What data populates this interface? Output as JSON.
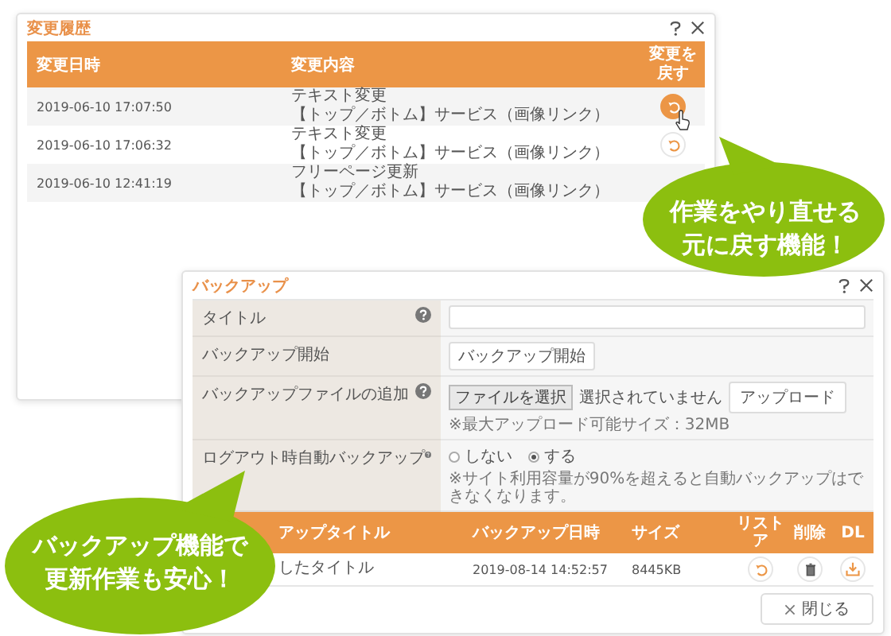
{
  "history_window": {
    "title": "変更履歴",
    "columns": [
      "変更日時",
      "変更内容",
      "変更を戻す"
    ],
    "rows": [
      {
        "date": "2019-06-10 17:07:50",
        "change": "テキスト変更",
        "target": "【トップ／ボトム】サービス（画像リンク）",
        "hovered": true
      },
      {
        "date": "2019-06-10 17:06:32",
        "change": "テキスト変更",
        "target": "【トップ／ボトム】サービス（画像リンク）",
        "hovered": false
      },
      {
        "date": "2019-06-10 12:41:19",
        "change": "フリーページ更新",
        "target": "【トップ／ボトム】サービス（画像リンク）"
      }
    ]
  },
  "backup_window": {
    "title": "バックアップ",
    "fields": [
      {
        "kind": "text_input",
        "label": "タイトル",
        "help": true
      },
      {
        "kind": "button",
        "label": "バックアップ開始",
        "help": false,
        "button": "バックアップ開始"
      },
      {
        "kind": "file",
        "label": "バックアップファイルの追加",
        "help": true,
        "file_button": "ファイルを選択",
        "file_status": "選択されていません",
        "upload": "アップロード",
        "note": "※最大アップロード可能サイズ：32MB"
      },
      {
        "kind": "radio",
        "label": "ログアウト時自動バックアップ",
        "help": true,
        "options": [
          {
            "label": "しない",
            "selected": false
          },
          {
            "label": "する",
            "selected": true
          }
        ],
        "note": "※サイト利用容量が90%を超えると自動バックアップはできなくなります。"
      }
    ],
    "table": {
      "columns": [
        "アップタイトル",
        "バックアップ日時",
        "サイズ",
        "リストア",
        "削除",
        "DL"
      ],
      "rows": [
        {
          "title": "したタイトル",
          "date": "2019-08-14 14:52:57",
          "size": "8445KB"
        }
      ]
    },
    "close_button": "閉じる"
  },
  "callouts": [
    {
      "lines": [
        "作業をやり直せる",
        "元に戻す機能！"
      ]
    },
    {
      "lines": [
        "バックアップ機能で",
        "更新作業も安心！"
      ]
    }
  ]
}
